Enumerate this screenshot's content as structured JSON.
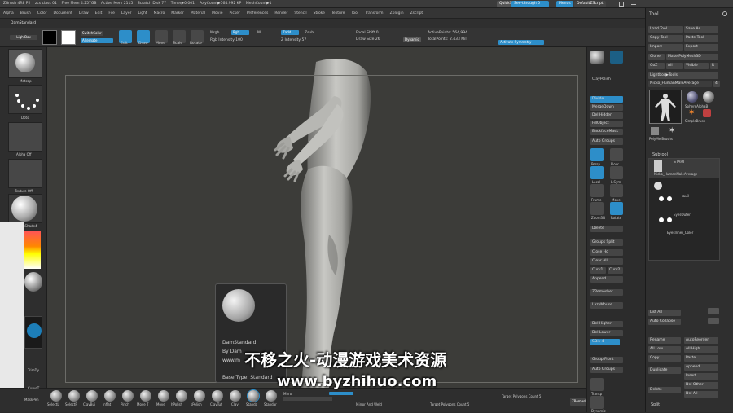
{
  "title_bar": {
    "app": "ZBrush 4R8 P2",
    "file": "zcs class 01",
    "free_mem": "Free Mem 4.257GB",
    "active_mem": "Active Mem 2115",
    "scratch": "Scratch Disk 77",
    "timer": "Timer▶0.001",
    "polycount": "PolyCount▶564.992 KP",
    "meshcount": "MeshCount▶1",
    "quicksave": "QuickSave",
    "see_through": "See-through 0",
    "menus": "Menus",
    "default_script": "DefaultZScript"
  },
  "menu_bar": [
    "Alpha",
    "Brush",
    "Color",
    "Document",
    "Draw",
    "Edit",
    "File",
    "Layer",
    "Light",
    "Macro",
    "Marker",
    "Material",
    "Movie",
    "Picker",
    "Preferences",
    "Render",
    "Stencil",
    "Stroke",
    "Texture",
    "Tool",
    "Transform",
    "Zplugin",
    "Zscript"
  ],
  "tab_strip": {
    "active": "DamStandard"
  },
  "top_shelf": {
    "lightbox": "LightBox",
    "switch_color": "SwitchColor",
    "alternate": "Alternate",
    "edit": "Edit",
    "draw": "Draw",
    "move": "Move",
    "scale": "Scale",
    "rotate": "Rotate",
    "mrgb": "Mrgb",
    "rgb": "Rgb",
    "m": "M",
    "zadd": "Zadd",
    "zsub": "Zsub",
    "rgb_intensity": "Rgb Intensity 100",
    "z_intensity": "Z Intensity 57",
    "focal_shift": "Focal Shift 0",
    "draw_size": "Draw Size 26",
    "dynamic": "Dynamic",
    "active_points": "ActivePoints: 564,994",
    "total_points": "TotalPoints: 2.433 Mil",
    "activate_symmetry": "Activate Symmetry"
  },
  "left_shelf": {
    "material_label": "Matcap",
    "dots_label": "Dots",
    "alpha_label": "Alpha Off",
    "texture_label": "Texture Off",
    "material2_label": "SkinShade4"
  },
  "right_shelf": {
    "claypolish": "ClayPolish",
    "divide": "Divide",
    "merge_down": "MergeDown",
    "del_hidden": "Del Hidden",
    "fill_object": "FillObject",
    "backface_mask": "BackfaceMask",
    "auto_groups": "Auto Groups",
    "persp": "Persp",
    "floor": "Floor",
    "local": "Local",
    "lsym": "L.Sym",
    "frame": "Frame",
    "move": "Move",
    "zoom3d": "Zoom3D",
    "rotate": "Rotate",
    "delete": "Delete",
    "groups_split": "Groups Split",
    "close_holes": "Close Ho",
    "clear_all": "Clear All",
    "curv1": "Curv1",
    "curv2": "Curv2",
    "append": "Append",
    "zremesher": "ZRemesher",
    "lazymouse": "LazyMouse",
    "del_higher": "Del Higher",
    "del_lower": "Del Lower",
    "sdiv": "SDiv 4",
    "group_front": "Group Front",
    "auto_groups2": "Auto Groups",
    "transp": "Transp",
    "dynamic": "Dynamic"
  },
  "tool_panel": {
    "header": "Tool",
    "load_tool": "Load Tool",
    "save_as": "Save As",
    "copy_tool": "Copy Tool",
    "paste_tool": "Paste Tool",
    "import": "Import",
    "export": "Export",
    "clone": "Clone",
    "make_polymesh": "Make PolyMesh3D",
    "goz": "GoZ",
    "all": "All",
    "visible": "Visible",
    "r": "R",
    "lightbox_tools": "Lightbox▶Tools",
    "tool_name": "Nicko_HumanMaleAverage",
    "tool_count": "4",
    "sphere_alphab": "SphereAlphaB",
    "simple_brush": "SimpleBrush",
    "eraser": "EraserB",
    "polymesh_brushes": "PolyMe Brushs",
    "subtool": "Subtool",
    "start": "START",
    "subtool1": "Nicko_HumanMaleAverage",
    "subtool2": "rauil",
    "subtool3": "EyesOuter",
    "subtool4": "EyesInner_Color",
    "list_all": "List All",
    "auto_collapse": "Auto Collapse",
    "rename": "Rename",
    "auto_reorder": "AutoReorder",
    "all_low": "All Low",
    "all_high": "All High",
    "copy": "Copy",
    "paste": "Paste",
    "duplicate": "Duplicate",
    "append": "Append",
    "insert": "Insert",
    "delete": "Delete",
    "del_other": "Del Other",
    "del_all": "Del All",
    "split": "Split"
  },
  "popup": {
    "name": "DamStandard",
    "by": "By Dam",
    "url": "www.m",
    "base_type": "Base Type: Standard"
  },
  "bottom_shelf": {
    "brushes": [
      "SelectL",
      "SelectR",
      "ClayBui",
      "Inflat",
      "Pinch",
      "Move T",
      "Move",
      "hPolish",
      "sPolish",
      "ClayTut",
      "Clay",
      "Standa",
      "Standar",
      "Mirror"
    ],
    "mirror_weld": "Mirror And Weld",
    "target_polygons": "Target Polygons Count 5",
    "target_polygons2": "Target Polygons Count 5",
    "dynamesh": "DynaMesh",
    "zremesh": "ZRemesh",
    "trimdy": "TrimDy",
    "curvetube": "CurveT",
    "mask": "MaskPen",
    "zremesher_btn": "ZRemesher"
  },
  "watermark": {
    "line1": "不移之火-动漫游戏美术资源",
    "line2": "www.byzhihuo.com"
  },
  "colors": {
    "accent": "#2d8ec9",
    "panel": "#2f2f2f",
    "canvas": "#3c3c39"
  }
}
